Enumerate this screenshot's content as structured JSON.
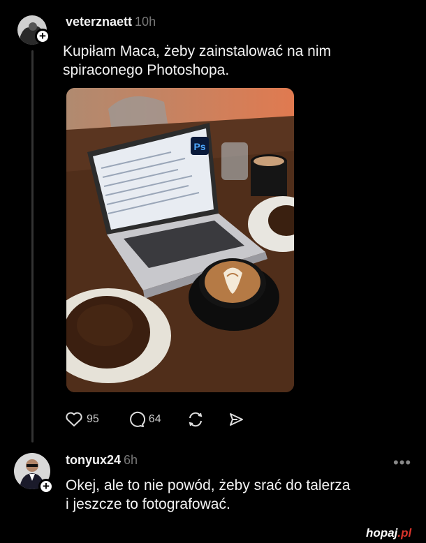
{
  "post": {
    "username": "veterznaett",
    "time": "10h",
    "text_line1": "Kupiłam Maca, żeby zainstalować na nim",
    "text_line2": "spiraconego Photoshopa.",
    "photo_label": "Ps",
    "likes": "95",
    "comments": "64"
  },
  "reply": {
    "username": "tonyux24",
    "time": "6h",
    "text_line1": "Okej, ale to nie powód, żeby srać do talerza",
    "text_line2": "i jeszcze to fotografować.",
    "more_label": "•••"
  },
  "watermark": {
    "name": "hopaj",
    "tld": ".pl"
  },
  "colors": {
    "background": "#000000",
    "text": "#f3f3f3",
    "muted": "#777777",
    "accent_watermark": "#d9342b"
  },
  "icons": [
    "heart-icon",
    "comment-icon",
    "repost-icon",
    "share-icon",
    "follow-plus-icon"
  ]
}
